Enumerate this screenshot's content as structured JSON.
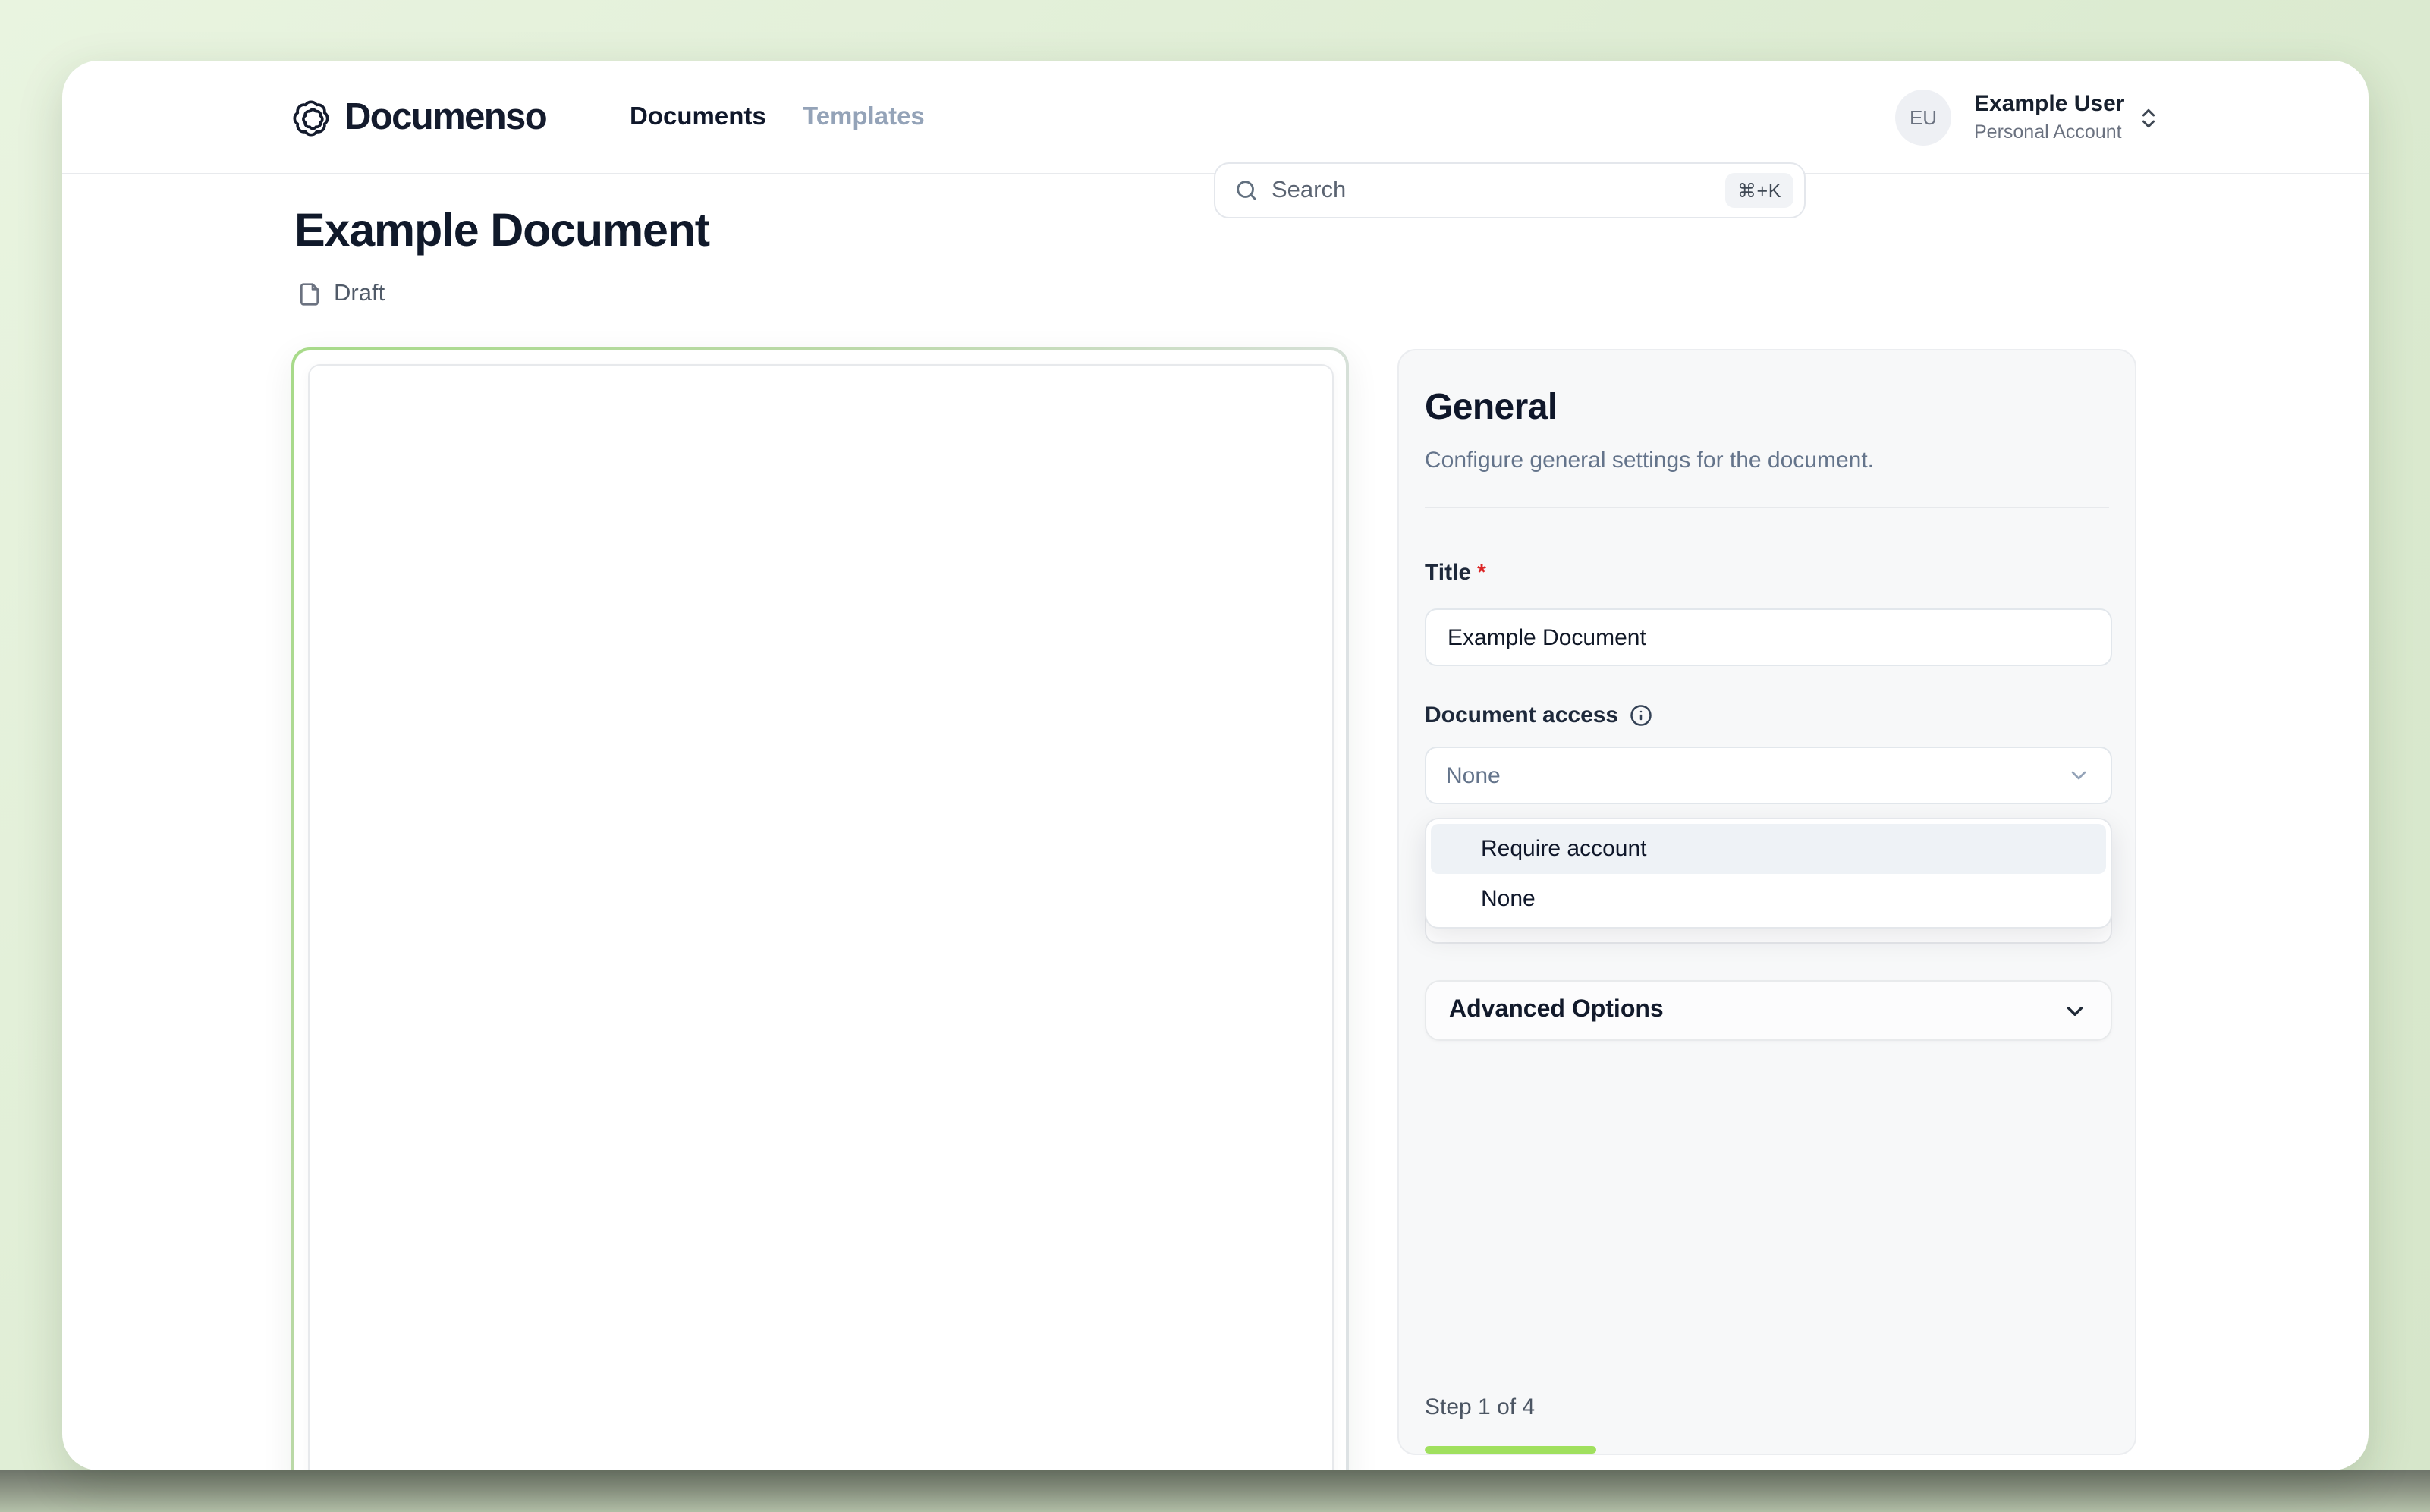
{
  "header": {
    "brand": "Documenso",
    "nav": [
      {
        "label": "Documents"
      },
      {
        "label": "Templates"
      }
    ],
    "search": {
      "placeholder": "Search",
      "shortcut": "⌘+K"
    },
    "user": {
      "initials": "EU",
      "name": "Example User",
      "account_type": "Personal Account"
    }
  },
  "page": {
    "title": "Example Document",
    "status": "Draft"
  },
  "settings_panel": {
    "title": "General",
    "subtitle": "Configure general settings for the document.",
    "fields": {
      "title": {
        "label": "Title",
        "required_marker": "*",
        "value": "Example Document"
      },
      "document_access": {
        "label": "Document access",
        "value": "None",
        "options": [
          "Require account",
          "None"
        ],
        "highlighted_option": "Require account"
      }
    },
    "advanced_options_label": "Advanced Options",
    "stepper": {
      "label": "Step 1 of 4",
      "progress_percent": 25
    }
  },
  "colors": {
    "accent_green": "#a2e771",
    "doc_border_green": "#a7da89",
    "highlight_row": "#eef2f6",
    "backdrop_green": "#dcebd1",
    "text_dark": "#0f172a",
    "text_muted": "#64748b"
  }
}
